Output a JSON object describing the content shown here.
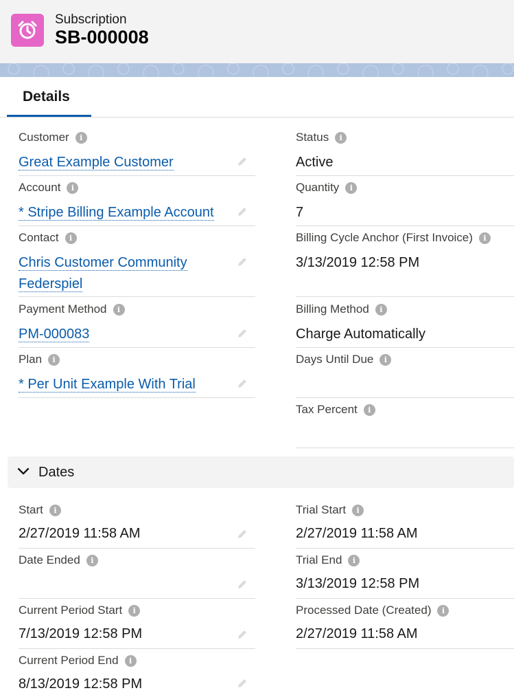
{
  "header": {
    "object_type": "Subscription",
    "record_name": "SB-000008",
    "icon": "alarm-clock-icon",
    "icon_color": "#e566c6"
  },
  "tabs": [
    {
      "label": "Details",
      "active": true
    }
  ],
  "details": {
    "customer": {
      "label": "Customer",
      "value": "Great Example Customer"
    },
    "account": {
      "label": "Account",
      "value": "* Stripe Billing Example Account"
    },
    "contact": {
      "label": "Contact",
      "value_line1": "Chris Customer Community",
      "value_line2": "Federspiel"
    },
    "payment_method": {
      "label": "Payment Method",
      "value": "PM-000083"
    },
    "plan": {
      "label": "Plan",
      "value": "* Per Unit Example With Trial"
    },
    "status": {
      "label": "Status",
      "value": "Active"
    },
    "quantity": {
      "label": "Quantity",
      "value": "7"
    },
    "billing_cycle_anchor": {
      "label": "Billing Cycle Anchor (First Invoice)",
      "value": "3/13/2019 12:58 PM"
    },
    "billing_method": {
      "label": "Billing Method",
      "value": "Charge Automatically"
    },
    "days_until_due": {
      "label": "Days Until Due",
      "value": ""
    },
    "tax_percent": {
      "label": "Tax Percent",
      "value": ""
    }
  },
  "dates_section": {
    "title": "Dates",
    "start": {
      "label": "Start",
      "value": "2/27/2019 11:58 AM"
    },
    "date_ended": {
      "label": "Date Ended",
      "value": ""
    },
    "current_period_start": {
      "label": "Current Period Start",
      "value": "7/13/2019 12:58 PM"
    },
    "current_period_end": {
      "label": "Current Period End",
      "value": "8/13/2019 12:58 PM"
    },
    "trial_start": {
      "label": "Trial Start",
      "value": "2/27/2019 11:58 AM"
    },
    "trial_end": {
      "label": "Trial End",
      "value": "3/13/2019 12:58 PM"
    },
    "processed_date": {
      "label": "Processed Date (Created)",
      "value": "2/27/2019 11:58 AM"
    }
  },
  "colors": {
    "link": "#0b5cab",
    "tab_active": "#0b5cab",
    "info_icon": "#aeaeae"
  }
}
